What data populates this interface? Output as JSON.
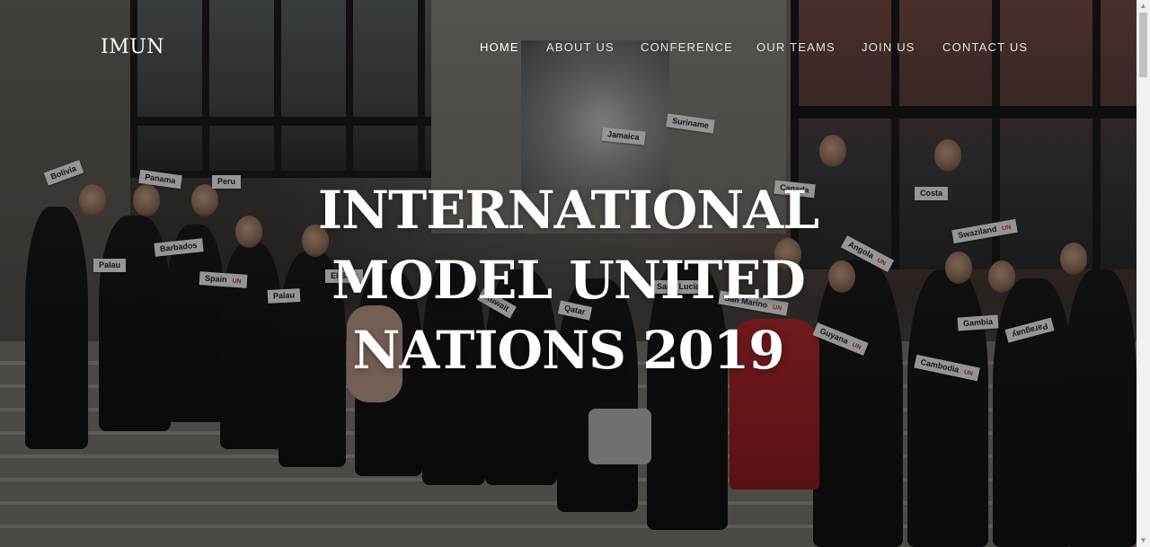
{
  "site": {
    "logo": "IMUN"
  },
  "nav": {
    "items": [
      {
        "label": "HOME",
        "active": true
      },
      {
        "label": "ABOUT US"
      },
      {
        "label": "CONFERENCE"
      },
      {
        "label": "OUR TEAMS"
      },
      {
        "label": "JOIN US"
      },
      {
        "label": "CONTACT US"
      }
    ]
  },
  "hero": {
    "title_line1": "INTERNATIONAL",
    "title_line2": "MODEL UNITED",
    "title_line3": "NATIONS 2019"
  },
  "placards": [
    "Bolivia",
    "Panama",
    "Peru",
    "Barbados",
    "Palau",
    "Spain",
    "Palau",
    "El Salv",
    "Jamaica",
    "Suriname",
    "Canada",
    "Costa",
    "Swaziland",
    "Angola",
    "Qatar",
    "San Marino",
    "Guyana",
    "Gambia",
    "Paraguay",
    "Cambodia",
    "Kuwait",
    "Saint Lucia"
  ],
  "colors": {
    "nav_text": "#e3e3e3",
    "title_text": "#ffffff",
    "jacket_red": "#b42a2f"
  }
}
